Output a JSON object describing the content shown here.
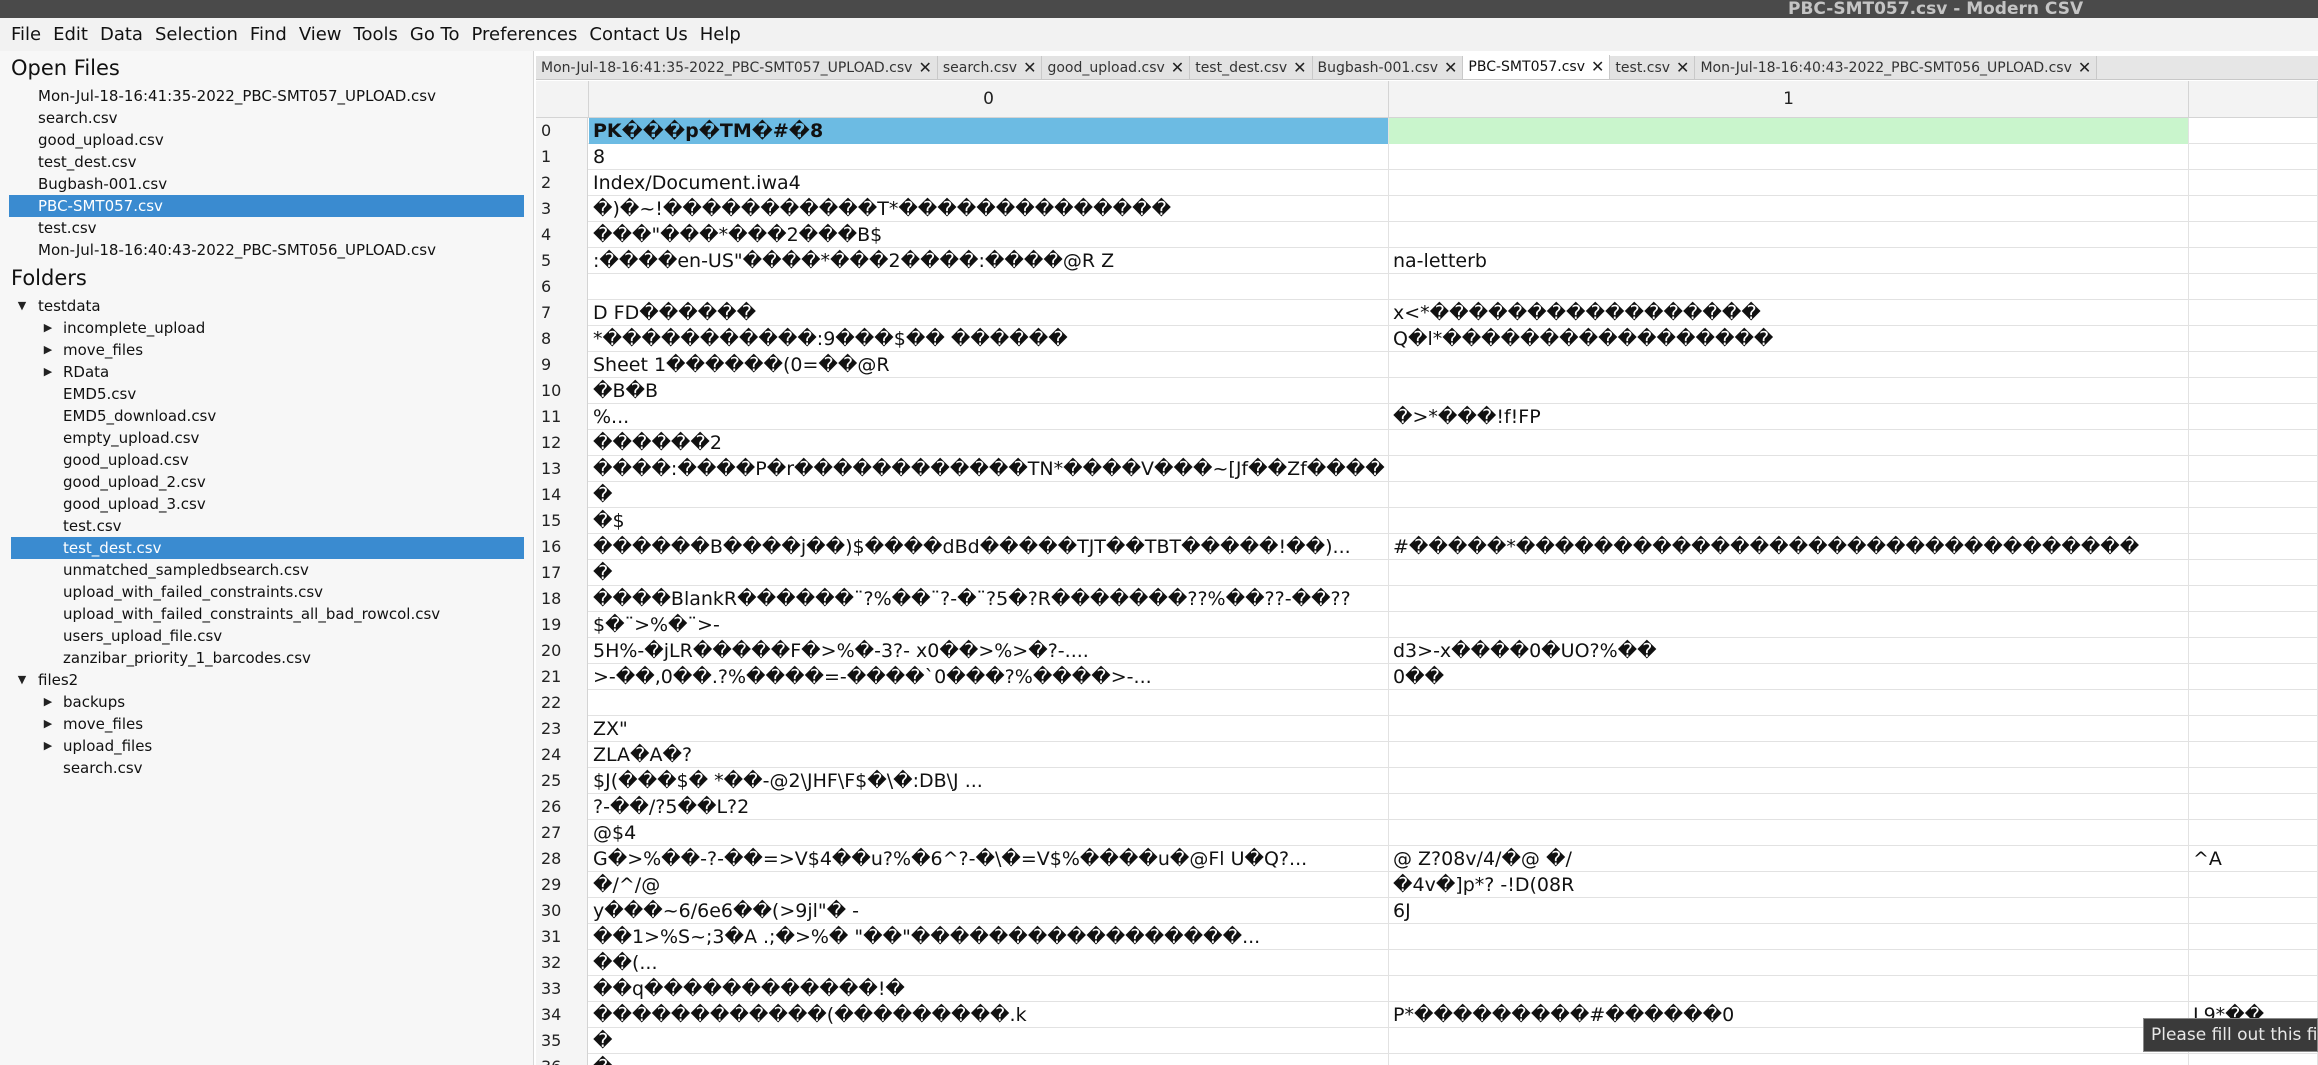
{
  "window": {
    "title": "PBC-SMT057.csv - Modern CSV"
  },
  "menu": [
    "File",
    "Edit",
    "Data",
    "Selection",
    "Find",
    "View",
    "Tools",
    "Go To",
    "Preferences",
    "Contact Us",
    "Help"
  ],
  "sidebar": {
    "open_files_title": "Open Files",
    "open_files": [
      "Mon-Jul-18-16:41:35-2022_PBC-SMT057_UPLOAD.csv",
      "search.csv",
      "good_upload.csv",
      "test_dest.csv",
      "Bugbash-001.csv",
      "PBC-SMT057.csv",
      "test.csv",
      "Mon-Jul-18-16:40:43-2022_PBC-SMT056_UPLOAD.csv"
    ],
    "selected_open_file": 5,
    "folders_title": "Folders",
    "tree": [
      {
        "label": "testdata",
        "depth": 0,
        "arrow": "▼"
      },
      {
        "label": "incomplete_upload",
        "depth": 1,
        "arrow": "▶"
      },
      {
        "label": "move_files",
        "depth": 1,
        "arrow": "▶"
      },
      {
        "label": "RData",
        "depth": 1,
        "arrow": "▶"
      },
      {
        "label": "EMD5.csv",
        "depth": 1,
        "arrow": ""
      },
      {
        "label": "EMD5_download.csv",
        "depth": 1,
        "arrow": ""
      },
      {
        "label": "empty_upload.csv",
        "depth": 1,
        "arrow": ""
      },
      {
        "label": "good_upload.csv",
        "depth": 1,
        "arrow": ""
      },
      {
        "label": "good_upload_2.csv",
        "depth": 1,
        "arrow": ""
      },
      {
        "label": "good_upload_3.csv",
        "depth": 1,
        "arrow": ""
      },
      {
        "label": "test.csv",
        "depth": 1,
        "arrow": ""
      },
      {
        "label": "test_dest.csv",
        "depth": 1,
        "arrow": "",
        "selected": true
      },
      {
        "label": "unmatched_sampledbsearch.csv",
        "depth": 1,
        "arrow": ""
      },
      {
        "label": "upload_with_failed_constraints.csv",
        "depth": 1,
        "arrow": ""
      },
      {
        "label": "upload_with_failed_constraints_all_bad_rowcol.csv",
        "depth": 1,
        "arrow": ""
      },
      {
        "label": "users_upload_file.csv",
        "depth": 1,
        "arrow": ""
      },
      {
        "label": "zanzibar_priority_1_barcodes.csv",
        "depth": 1,
        "arrow": ""
      },
      {
        "label": "files2",
        "depth": 0,
        "arrow": "▼"
      },
      {
        "label": "backups",
        "depth": 1,
        "arrow": "▶"
      },
      {
        "label": "move_files",
        "depth": 1,
        "arrow": "▶"
      },
      {
        "label": "upload_files",
        "depth": 1,
        "arrow": "▶"
      },
      {
        "label": "search.csv",
        "depth": 1,
        "arrow": ""
      }
    ]
  },
  "tabs": [
    {
      "label": "Mon-Jul-18-16:41:35-2022_PBC-SMT057_UPLOAD.csv",
      "active": false
    },
    {
      "label": "search.csv",
      "active": false
    },
    {
      "label": "good_upload.csv",
      "active": false
    },
    {
      "label": "test_dest.csv",
      "active": false
    },
    {
      "label": "Bugbash-001.csv",
      "active": false
    },
    {
      "label": "PBC-SMT057.csv",
      "active": true
    },
    {
      "label": "test.csv",
      "active": false
    },
    {
      "label": "Mon-Jul-18-16:40:43-2022_PBC-SMT056_UPLOAD.csv",
      "active": false
    }
  ],
  "tab_close_glyph": "✕",
  "grid": {
    "column_headers": [
      "0",
      "1"
    ],
    "rows": [
      [
        "PK���p�TM�#�8",
        "",
        ""
      ],
      [
        "8",
        "",
        ""
      ],
      [
        "Index/Document.iwa4",
        "",
        ""
      ],
      [
        "�)�~!�����������T*��������������",
        "",
        ""
      ],
      [
        "���\"���*���2���B$",
        "",
        ""
      ],
      [
        ":����en-US\"����*���2����:����@R Z",
        "na-letterb",
        ""
      ],
      [
        "",
        "",
        ""
      ],
      [
        "D FD������",
        "x<*�����������������",
        ""
      ],
      [
        "*�����������:9���$�� ������",
        "Q�l*�����������������",
        ""
      ],
      [
        "Sheet 1������(0=��@R",
        "",
        ""
      ],
      [
        "�B�B",
        "",
        ""
      ],
      [
        "%...",
        "�>*���!f!FP",
        ""
      ],
      [
        "������2",
        "",
        ""
      ],
      [
        "����:����P�r������������TN*����V���~[Jf��Zf����",
        "",
        ""
      ],
      [
        "�",
        "",
        ""
      ],
      [
        "�$",
        "",
        ""
      ],
      [
        "������B����j��)$����dBd�����TJT��TBT�����!��)...",
        "#�����*��������������������������������",
        ""
      ],
      [
        "�",
        "",
        ""
      ],
      [
        "����BlankR������¨?%��¨?-�¨?5�?R�������??%��??-��??",
        "",
        ""
      ],
      [
        "$�¨>%�¨>-",
        "",
        ""
      ],
      [
        "5H%-�jLR�����F�>%�-3?- x0��>%>�?-....",
        "d3>-x����0�UO?%��",
        ""
      ],
      [
        ">-��,0��.?%����=-����`0���?%����>-...",
        "0��",
        ""
      ],
      [
        "",
        "",
        ""
      ],
      [
        "ZX\"",
        "",
        ""
      ],
      [
        "ZLA�A�?",
        "",
        ""
      ],
      [
        "$J(���$�  *��-@2\\JHF\\F$�\\�:DB\\J ...",
        "",
        ""
      ],
      [
        "?-��/?5��L?2",
        "",
        ""
      ],
      [
        "@$4",
        "",
        ""
      ],
      [
        "G�>%��-?-��=>V$4��u?%�6^?-�\\�=V$%����u�@Fl U�Q?...",
        "@ Z?08v/4/�@ �/",
        "^A"
      ],
      [
        "�/^/@",
        "�4v�]p*? -!D(08R",
        ""
      ],
      [
        "y���~6/6e6��(>9jl\"� -",
        "6J",
        ""
      ],
      [
        "��1>%S~;3�A .;�>%� \"��\"�����������������...",
        "",
        ""
      ],
      [
        "��(...",
        "",
        ""
      ],
      [
        "��q������������!�",
        "",
        ""
      ],
      [
        "������������(���������.k",
        "P*���������#������0",
        "L9*��"
      ],
      [
        "�",
        "",
        ""
      ],
      [
        "�",
        "",
        ""
      ]
    ]
  },
  "tooltip": {
    "text": "Please fill out this fie"
  },
  "colors": {
    "selection": "#3a8bd0",
    "header_cell": "#6cbbe3",
    "green_cell": "#c9f5cc",
    "titlebar": "#4a4a4a"
  }
}
